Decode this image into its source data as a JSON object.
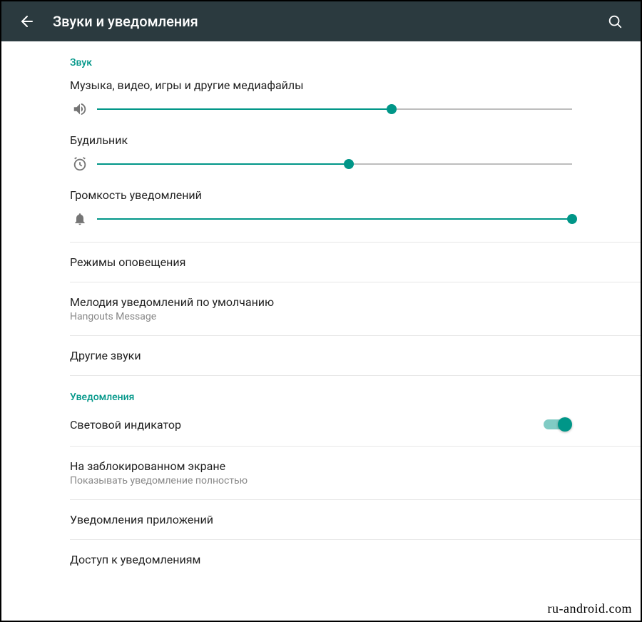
{
  "appbar": {
    "title": "Звуки и уведомления"
  },
  "sections": {
    "sound_header": "Звук",
    "notifications_header": "Уведомления"
  },
  "sliders": {
    "media": {
      "label": "Музыка, видео, игры и другие медиафайлы",
      "value": 62
    },
    "alarm": {
      "label": "Будильник",
      "value": 53
    },
    "notification": {
      "label": "Громкость уведомлений",
      "value": 100
    }
  },
  "rows": {
    "interruptions": {
      "primary": "Режимы оповещения"
    },
    "default_ringtone": {
      "primary": "Мелодия уведомлений по умолчанию",
      "secondary": "Hangouts Message"
    },
    "other_sounds": {
      "primary": "Другие звуки"
    },
    "pulse_light": {
      "primary": "Световой индикатор",
      "switch_on": true
    },
    "lock_screen": {
      "primary": "На заблокированном экране",
      "secondary": "Показывать уведомление полностью"
    },
    "app_notifications": {
      "primary": "Уведомления приложений"
    },
    "notification_access": {
      "primary": "Доступ к уведомлениям"
    }
  },
  "watermark": "ru-android.com",
  "colors": {
    "accent": "#009688",
    "appbar_bg": "#2b3a3f"
  }
}
